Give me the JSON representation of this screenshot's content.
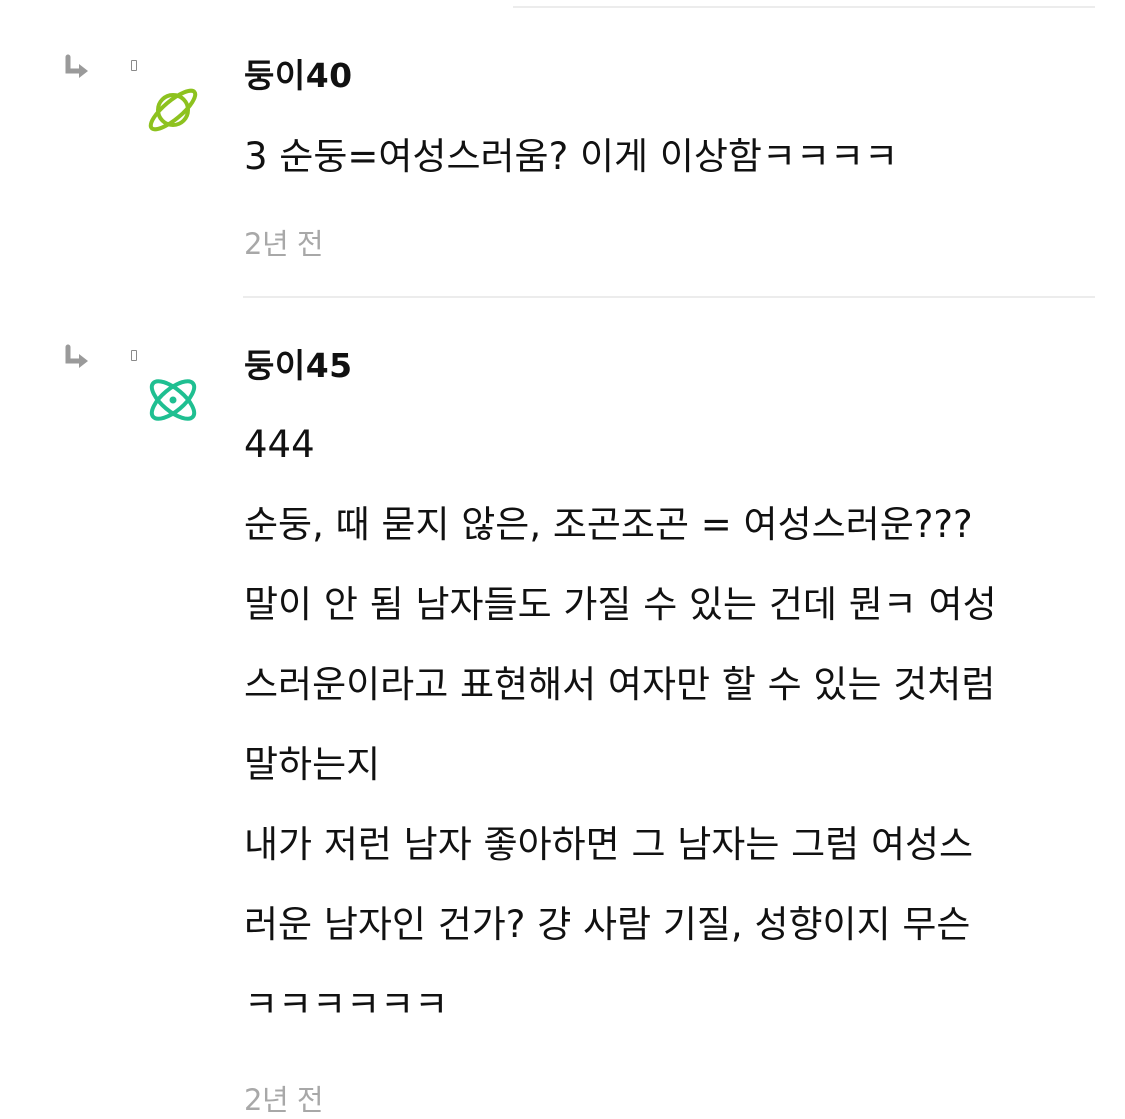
{
  "comments": [
    {
      "nickname": "둥이40",
      "avatar_icon": "planet-icon",
      "avatar_color": "#8dc21f",
      "lines": [
        "3 순둥=여성스러움? 이게 이상함ㅋㅋㅋㅋ"
      ],
      "time": "2년 전"
    },
    {
      "nickname": "둥이45",
      "avatar_icon": "atom-icon",
      "avatar_color": "#1fbf91",
      "lines": [
        "444",
        "순둥, 때 묻지 않은, 조곤조곤 = 여성스러운???",
        "말이 안 됨 남자들도 가질 수 있는 건데 뭔ㅋ 여성",
        "스러운이라고 표현해서 여자만 할 수 있는 것처럼",
        "말하는지",
        "내가 저런 남자 좋아하면 그 남자는 그럼 여성스",
        "러운 남자인 건가? 걍 사람 기질, 성향이지 무슨",
        "ㅋㅋㅋㅋㅋㅋ"
      ],
      "time": "2년 전"
    }
  ]
}
